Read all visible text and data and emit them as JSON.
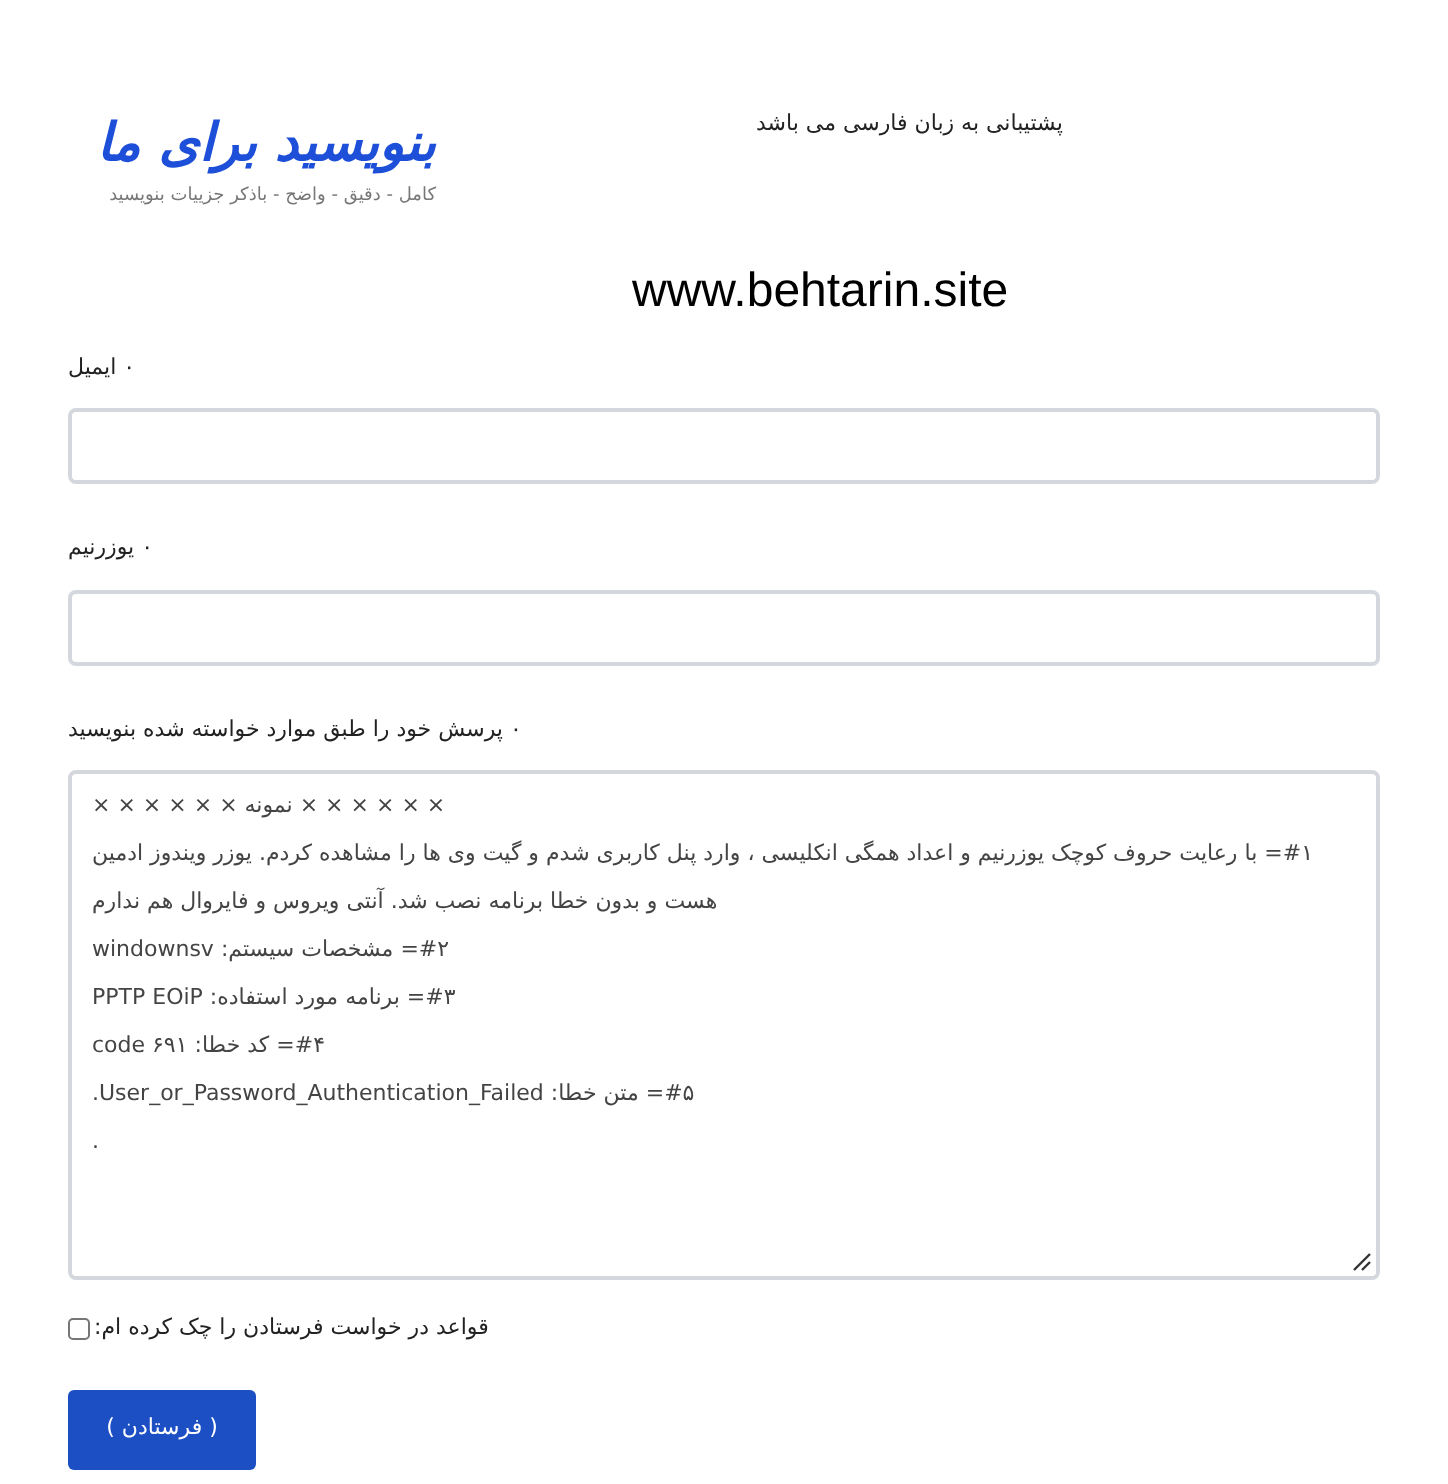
{
  "logo": {
    "text": "بنویسید برای ما",
    "tagline": "کامل - دقیق - واضح - باذکر جزییات بنویسید"
  },
  "header_note": "پشتیبانی به زبان فارسی می باشد",
  "title": "www.behtarin.site",
  "fields": [
    {
      "kind": "input",
      "label": "۰ ایمیل"
    },
    {
      "kind": "input",
      "label": "۰ یوزرنیم"
    },
    {
      "kind": "textarea",
      "label": "۰ پرسش خود را طبق موارد خواسته شده بنویسید",
      "lines": [
        "× × × × × × نمونه × × × × × ×",
        "#۱= با رعایت حروف کوچک یوزرنیم و اعداد همگی انکلیسی ، وارد پنل کاربری شدم و گیت وی ها را مشاهده کردم. یوزر ویندوز ادمین",
        "هست و بدون خطا برنامه نصب شد. آنتی ویروس و فایروال هم ندارم",
        "#۲= مشخصات سیستم: windownsv",
        "#۳= برنامه مورد استفاده: PPTP EOiP",
        "#۴= کد خطا: code ۶۹۱",
        "#۵= متن خطا: User_or_Password_Authentication_Failed.",
        "."
      ]
    }
  ],
  "agreement": {
    "label": "قواعد در خواست فرستادن را چک کرده ام:",
    "checked": false
  },
  "submit": "( فرستادن )"
}
